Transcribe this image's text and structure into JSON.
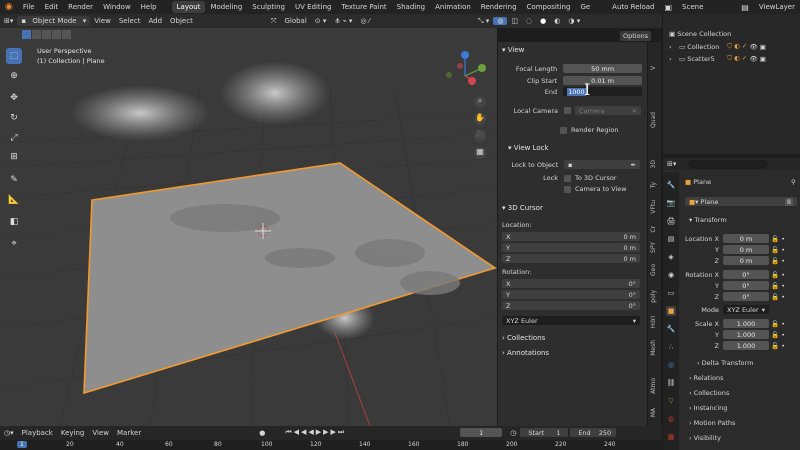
{
  "menu": {
    "items": [
      "File",
      "Edit",
      "Render",
      "Window",
      "Help"
    ],
    "workspaces": [
      "Layout",
      "Modeling",
      "Sculpting",
      "UV Editing",
      "Texture Paint",
      "Shading",
      "Animation",
      "Rendering",
      "Compositing",
      "Ge"
    ],
    "auto_reload": "Auto Reload",
    "scene": "Scene",
    "view_layer": "ViewLayer"
  },
  "viewport_header": {
    "mode": "Object Mode",
    "menus": [
      "View",
      "Select",
      "Add",
      "Object"
    ],
    "transform": "Global",
    "options": "Options"
  },
  "viewport": {
    "perspective": "User Perspective",
    "collection": "(1) Collection | Plane"
  },
  "npanel": {
    "view": {
      "title": "View",
      "focal_length_label": "Focal Length",
      "focal_length": "50 mm",
      "clip_start_label": "Clip Start",
      "clip_start": "0.01 m",
      "end_label": "End",
      "end_value": "1000",
      "local_camera_label": "Local Camera",
      "camera_placeholder": "Camera",
      "render_region": "Render Region"
    },
    "view_lock": {
      "title": "View Lock",
      "lock_to_object": "Lock to Object",
      "lock_label": "Lock",
      "to_3d_cursor": "To 3D Cursor",
      "camera_to_view": "Camera to View"
    },
    "cursor": {
      "title": "3D Cursor",
      "location": "Location:",
      "x": "X",
      "y": "Y",
      "z": "Z",
      "loc_x": "0 m",
      "loc_y": "0 m",
      "loc_z": "0 m",
      "rotation": "Rotation:",
      "rot_x": "0°",
      "rot_y": "0°",
      "rot_z": "0°",
      "rot_mode": "XYZ Euler"
    },
    "collections": "Collections",
    "annotations": "Annotations",
    "tabs": [
      "Quad",
      "3D",
      "Ty",
      "VFtu",
      "Cr",
      "SPY",
      "Geo",
      "poly",
      "Hdri",
      "Mesh",
      "Atmo",
      "MA"
    ]
  },
  "outliner": {
    "scene_collection": "Scene Collection",
    "items": [
      "Collection",
      "Scatter5"
    ]
  },
  "properties": {
    "object": "Plane",
    "name": "Plane",
    "transform": "Transform",
    "location_x_label": "Location X",
    "y": "Y",
    "z": "Z",
    "loc_x": "0 m",
    "loc_y": "0 m",
    "loc_z": "0 m",
    "rotation_x_label": "Rotation X",
    "rot_x": "0°",
    "rot_y": "0°",
    "rot_z": "0°",
    "mode_label": "Mode",
    "mode": "XYZ Euler",
    "scale_x_label": "Scale X",
    "scale_x": "1.000",
    "scale_y": "1.000",
    "scale_z": "1.000",
    "panels": [
      "Delta Transform",
      "Relations",
      "Collections",
      "Instancing",
      "Motion Paths",
      "Visibility"
    ]
  },
  "timeline": {
    "menus": [
      "Playback",
      "Keying",
      "View",
      "Marker"
    ],
    "frame": "1",
    "start_label": "Start",
    "start": "1",
    "end_label": "End",
    "end": "250",
    "ruler": [
      "1",
      "20",
      "40",
      "60",
      "80",
      "100",
      "120",
      "140",
      "160",
      "180",
      "200",
      "220",
      "240"
    ]
  },
  "colors": {
    "accent": "#4772b3",
    "selection": "#f29a2e",
    "plane": "#8e8e8e"
  }
}
